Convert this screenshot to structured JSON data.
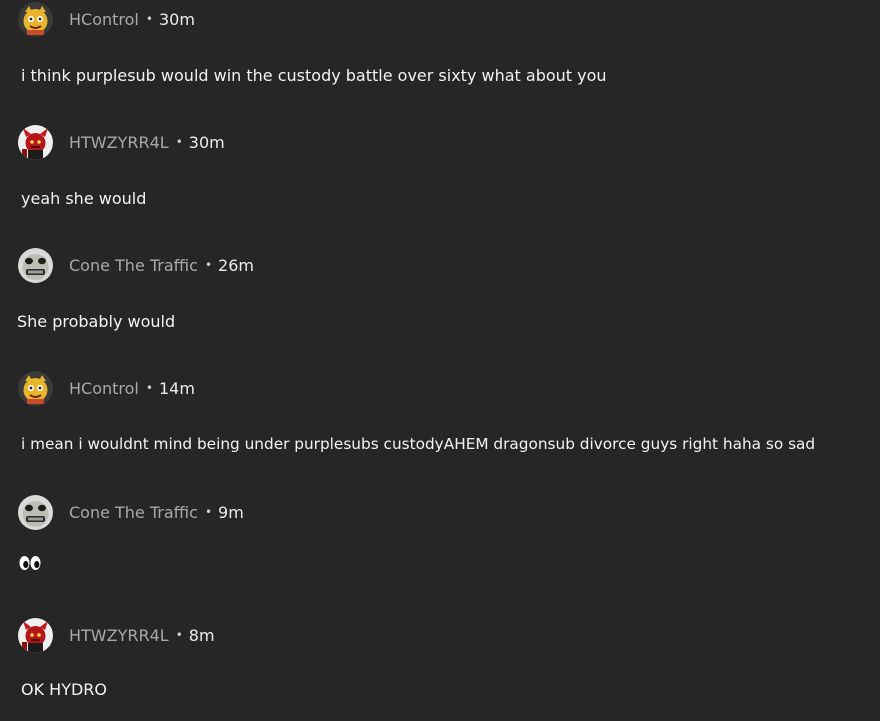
{
  "comments": [
    {
      "username": "HControl",
      "separator": "•",
      "time": "30m",
      "text": "i think purplesub would win the custody battle over sixty what about you",
      "avatar": "avatar-yellow-character-icon"
    },
    {
      "username": "HTWZYRR4L",
      "separator": "•",
      "time": "30m",
      "text": "yeah she would",
      "avatar": "avatar-red-demon-icon"
    },
    {
      "username": "Cone The Traffic",
      "separator": "•",
      "time": "26m",
      "text": "She probably would",
      "avatar": "avatar-grey-face-icon"
    },
    {
      "username": "HControl",
      "separator": "•",
      "time": "14m",
      "text": "i mean  i wouldnt  mind being under purplesubs custodyAHEM dragonsub divorce guys right haha so sad",
      "avatar": "avatar-yellow-character-icon"
    },
    {
      "username": "Cone The Traffic",
      "separator": "•",
      "time": "9m",
      "text": "",
      "emoji": "eyes-emoji-icon",
      "avatar": "avatar-grey-face-icon"
    },
    {
      "username": "HTWZYRR4L",
      "separator": "•",
      "time": "8m",
      "text": "OK HYDRO",
      "avatar": "avatar-red-demon-icon"
    }
  ]
}
